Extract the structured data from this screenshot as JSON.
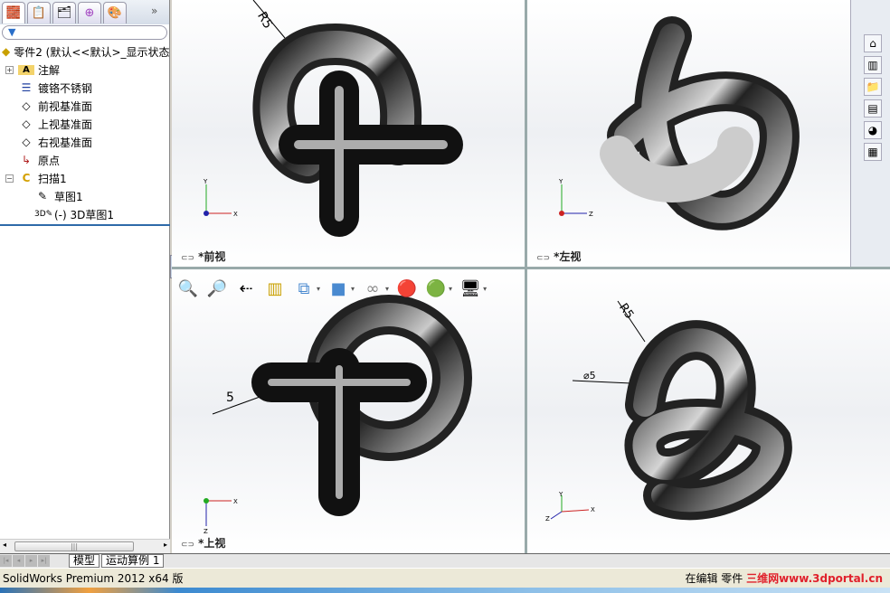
{
  "feature_manager": {
    "tabs": [
      "feature-manager",
      "property-manager",
      "configuration-manager",
      "dimxpert-manager",
      "display-manager"
    ],
    "more": "»",
    "filter_icon": "filter-icon",
    "tree": [
      {
        "label": "零件2  (默认<<默认>_显示状态",
        "icon": "part-icon",
        "level": 0
      },
      {
        "label": "注解",
        "icon": "annotations-icon",
        "level": 1,
        "expander": "+"
      },
      {
        "label": "镀铬不锈钢",
        "icon": "material-icon",
        "level": 1
      },
      {
        "label": "前视基准面",
        "icon": "plane-icon",
        "level": 1
      },
      {
        "label": "上视基准面",
        "icon": "plane-icon",
        "level": 1
      },
      {
        "label": "右视基准面",
        "icon": "plane-icon",
        "level": 1
      },
      {
        "label": "原点",
        "icon": "origin-icon",
        "level": 1
      },
      {
        "label": "扫描1",
        "icon": "sweep-icon",
        "level": 1,
        "expander": "−"
      },
      {
        "label": "草图1",
        "icon": "sketch-icon",
        "level": 2
      },
      {
        "label": "(-) 3D草图1",
        "icon": "3dsketch-icon",
        "level": 2
      }
    ]
  },
  "viewports": {
    "front": {
      "label": "*前视",
      "dim": "R5",
      "axes": [
        "Y",
        "X"
      ]
    },
    "left": {
      "label": "*左视",
      "axes": [
        "Y",
        "Z"
      ]
    },
    "top": {
      "label": "*上视",
      "dim": "5",
      "axes": [
        "X",
        "Z"
      ]
    },
    "iso": {
      "dim": "R5",
      "dim2": "⌀5",
      "axes": [
        "Y",
        "X",
        "Z"
      ]
    }
  },
  "heads_up_toolbar": [
    "zoom-to-fit",
    "zoom-to-area",
    "previous-view",
    "section-view",
    "view-orientation",
    "display-style",
    "hide-show-items",
    "edit-appearance",
    "apply-scene",
    "view-settings"
  ],
  "bottom_tabs": [
    "模型",
    "运动算例 1"
  ],
  "status": {
    "left": "SolidWorks Premium 2012 x64 版",
    "right": "在编辑 零件",
    "watermark": "三维网www.3dportal.cn"
  },
  "colors": {
    "accent": "#2e6aa9",
    "watermark": "#e0202b"
  }
}
